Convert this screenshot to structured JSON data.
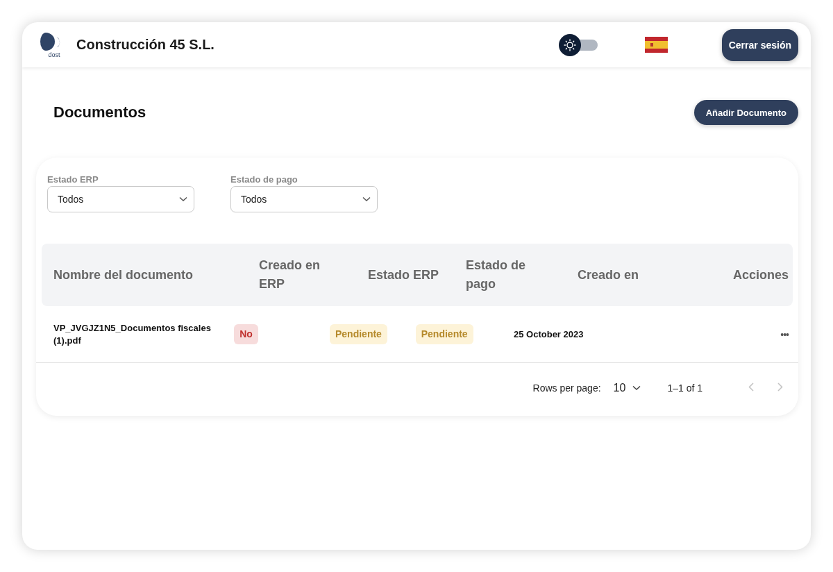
{
  "header": {
    "logo_text": "dost",
    "company": "Construcción 45 S.L.",
    "dark_mode": false,
    "logout": "Cerrar sesión"
  },
  "page": {
    "title": "Documentos",
    "add_button": "Añadir Documento"
  },
  "filters": [
    {
      "label": "Estado ERP",
      "value": "Todos"
    },
    {
      "label": "Estado de pago",
      "value": "Todos"
    }
  ],
  "table": {
    "columns": [
      "Nombre del documento",
      "Creado en ERP",
      "Estado ERP",
      "Estado de pago",
      "Creado en",
      "Acciones"
    ],
    "rows": [
      {
        "name": "VP_JVGJZ1N5_Documentos fiscales (1).pdf",
        "created_in_erp": {
          "text": "No",
          "kind": "danger"
        },
        "erp_status": {
          "text": "Pendiente",
          "kind": "warning"
        },
        "payment_status": {
          "text": "Pendiente",
          "kind": "warning"
        },
        "created_at": "25 October 2023",
        "actions": "•••"
      }
    ]
  },
  "pagination": {
    "rows_label": "Rows per page:",
    "rows_value": "10",
    "range": "1–1 of 1",
    "prev_disabled": true,
    "next_disabled": true
  }
}
